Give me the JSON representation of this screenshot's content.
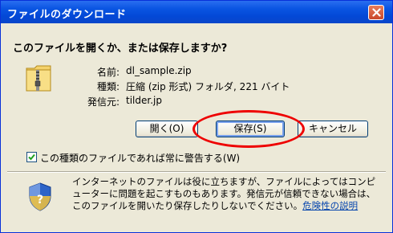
{
  "window": {
    "title": "ファイルのダウンロード"
  },
  "question": "このファイルを開くか、または保存しますか?",
  "file": {
    "name_label": "名前:",
    "name_value": "dl_sample.zip",
    "type_label": "種類:",
    "type_value": "圧縮 (zip 形式) フォルダ, 221 バイト",
    "from_label": "発信元:",
    "from_value": "tilder.jp"
  },
  "buttons": {
    "open": "開く(O)",
    "save": "保存(S)",
    "cancel": "キャンセル"
  },
  "checkbox": {
    "label": "この種類のファイルであれば常に警告する(W)",
    "checked": true
  },
  "warning": {
    "text": "インターネットのファイルは役に立ちますが、ファイルによってはコンピューターに問題を起こすものもあります。発信元が信頼できない場合は、このファイルを開いたり保存したりしないでください。",
    "link": "危険性の説明"
  },
  "colors": {
    "title_bar": "#0a55e2",
    "highlight": "#e00000"
  }
}
